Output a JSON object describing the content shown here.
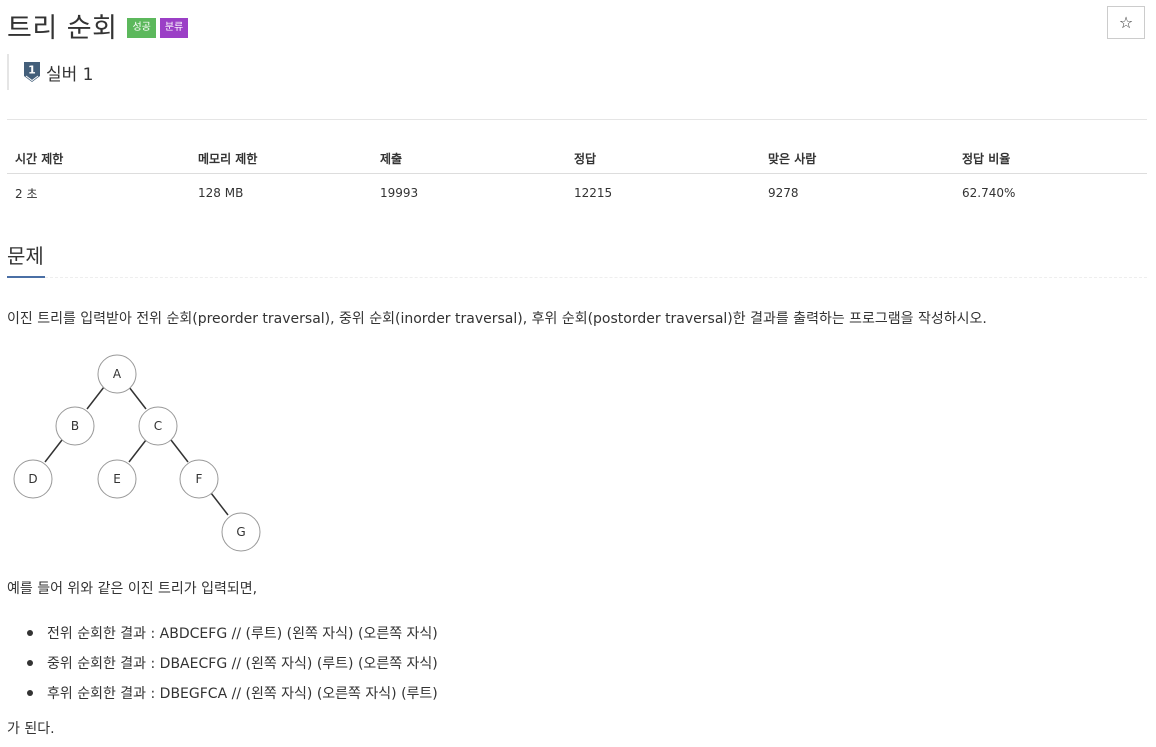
{
  "problem": {
    "title": "트리 순회",
    "badges": [
      "성공",
      "분류"
    ],
    "star_label": "☆",
    "tier_number": "1",
    "tier": "실버 1"
  },
  "info": {
    "headers": [
      "시간 제한",
      "메모리 제한",
      "제출",
      "정답",
      "맞은 사람",
      "정답 비율"
    ],
    "values": [
      "2 초",
      "128 MB",
      "19993",
      "12215",
      "9278",
      "62.740%"
    ]
  },
  "section": {
    "title": "문제",
    "description": "이진 트리를 입력받아 전위 순회(preorder traversal), 중위 순회(inorder traversal), 후위 순회(postorder traversal)한 결과를 출력하는 프로그램을 작성하시오.",
    "tree_nodes": [
      "A",
      "B",
      "C",
      "D",
      "E",
      "F",
      "G"
    ],
    "example_intro": "예를 들어 위와 같은 이진 트리가 입력되면,",
    "results": [
      "전위 순회한 결과 : ABDCEFG // (루트) (왼쪽 자식) (오른쪽 자식)",
      "중위 순회한 결과 : DBAECFG // (왼쪽 자식) (루트) (오른쪽 자식)",
      "후위 순회한 결과 : DBEGFCA // (왼쪽 자식) (오른쪽 자식) (루트)"
    ],
    "ending": "가 된다."
  },
  "colors": {
    "success_badge": "#5cb85c",
    "category_badge": "#9b3fc6",
    "section_underline": "#4a6fa5",
    "tier_icon": "#435f7a"
  }
}
